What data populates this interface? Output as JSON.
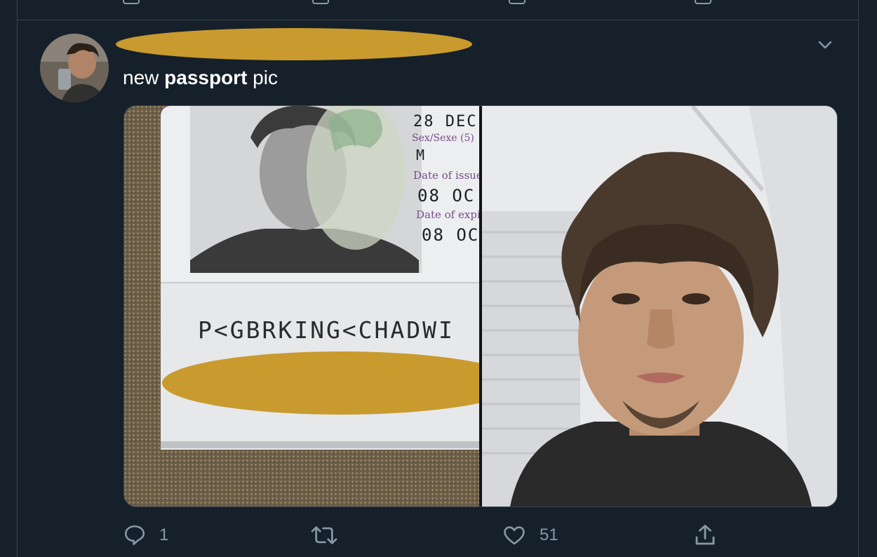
{
  "tweet": {
    "text_before": "new ",
    "text_bold": "passport",
    "text_after": " pic"
  },
  "media": {
    "passport": {
      "birth_date": "28 DEC",
      "sex_label": "Sex/Sexe (5)",
      "sex_value": "M",
      "issue_label": "Date of issue",
      "issue_value": "08 OC",
      "expiry_label": "Date of expi",
      "expiry_value": "08 OC",
      "mrz": "P<GBRKING<CHADWI"
    }
  },
  "actions": {
    "reply_count": "1",
    "like_count": "51"
  },
  "colors": {
    "background": "#15202b",
    "border": "#38444d",
    "secondary_text": "#8899a6",
    "redaction": "#c99a2e"
  }
}
